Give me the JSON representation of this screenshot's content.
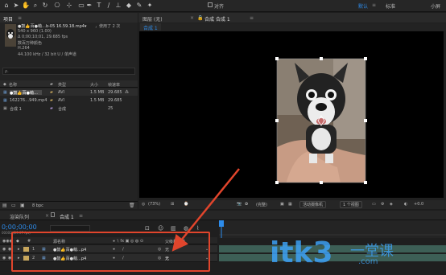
{
  "toolbar": {
    "align_label": "对齐",
    "workspace_default": "默认",
    "workspace_std": "标准",
    "workspace_small": "小屏"
  },
  "project": {
    "tab_label": "项目",
    "file_name": "●鼓👍百●萌…b-05 16.59.18.mp4▾",
    "used_count": "，使用了 2 次",
    "info_lines": [
      "540 x 960 (1.00)",
      "Δ 0;00;10;01, 29.685 fps",
      "数百万种颜色",
      "H.264",
      "44.100 kHz / 32 bit U / 单声道"
    ],
    "search_placeholder": "ρ.",
    "columns": [
      "名称",
      "类型",
      "大小",
      "帧速率"
    ],
    "rows": [
      {
        "name": "●鼓👍百●萌…",
        "type": "AVI",
        "size": "1.5 MB",
        "fps": "29.685"
      },
      {
        "name": "162276…949.mp4",
        "type": "AVI",
        "size": "1.5 MB",
        "fps": "29.685"
      },
      {
        "name": "合成 1",
        "type": "合成",
        "size": "",
        "fps": "25"
      }
    ],
    "bit_depth": "8 bpc"
  },
  "comp": {
    "layer_label": "图层 (无)",
    "comp_tab": "合成 合成 1",
    "sub_tab": "合成 1",
    "zoom": "(73%)",
    "resolution": "(完整)",
    "camera": "活动摄像机",
    "views": "1 个视图",
    "offset": "+0.0"
  },
  "timeline": {
    "render_tab": "渲染队列",
    "comp_tab": "合成 1",
    "timecode": "0;00;00;00",
    "fps_text": "00000 (29.97 fps)",
    "col_source": "源名称",
    "col_parent": "父级和链接",
    "layers": [
      {
        "num": "1",
        "name": "●鼓👍百●萌…p4",
        "parent": "无"
      },
      {
        "num": "2",
        "name": "●鼓👍百●萌…p4",
        "parent": "无"
      }
    ]
  },
  "watermark": {
    "text": "itk3",
    "sub": "一堂课",
    "domain": ".com"
  },
  "colors": {
    "accent": "#2d8ceb",
    "annotation": "#e1452c",
    "layer_bar": "#3d5f56"
  }
}
